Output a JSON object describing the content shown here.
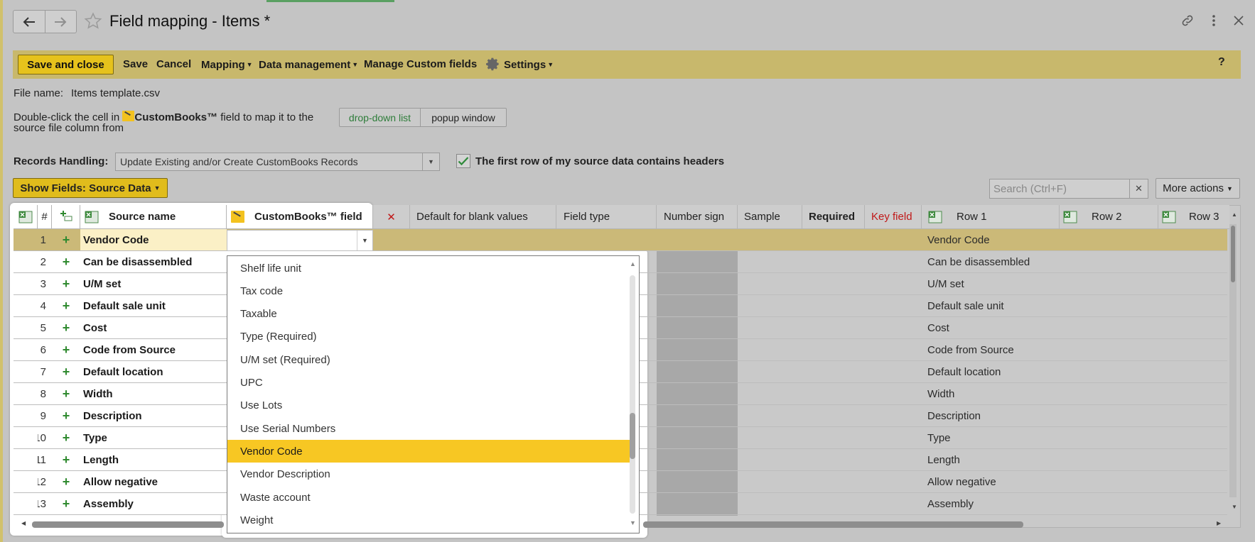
{
  "window": {
    "title": "Field mapping - Items *"
  },
  "toolbar": {
    "save_close": "Save and close",
    "save": "Save",
    "cancel": "Cancel",
    "mapping": "Mapping",
    "data_management": "Data management",
    "manage_custom_fields": "Manage Custom fields",
    "settings": "Settings",
    "help": "?"
  },
  "file": {
    "label": "File name:",
    "value": "Items template.csv"
  },
  "hint": {
    "line1_pre": "Double-click the cell in",
    "brand": "CustomBooks™",
    "line1_post": "field to map it to the",
    "line2": "source file column from"
  },
  "mode_toggle": {
    "dropdown": "drop-down list",
    "popup": "popup window",
    "active": "dropdown"
  },
  "records_handling": {
    "label": "Records Handling:",
    "value": "Update Existing and/or Create CustomBooks Records"
  },
  "headers_checkbox": {
    "label": "The first row of my source data contains headers",
    "checked": true
  },
  "show_fields": "Show Fields: Source Data",
  "search": {
    "placeholder": "Search (Ctrl+F)"
  },
  "more_actions": "More actions",
  "grid": {
    "columns": {
      "num": "#",
      "source_name": "Source name",
      "custombooks_field": "CustomBooks™ field",
      "default_blank": "Default for blank values",
      "field_type": "Field type",
      "number_sign": "Number sign",
      "sample": "Sample",
      "required": "Required",
      "key_field": "Key field",
      "row1": "Row 1",
      "row2": "Row 2",
      "row3": "Row 3"
    },
    "rows": [
      {
        "n": "1",
        "source": "Vendor Code",
        "row1": "Vendor Code"
      },
      {
        "n": "2",
        "source": "Can be disassembled",
        "row1": "Can be disassembled"
      },
      {
        "n": "3",
        "source": "U/M set",
        "row1": "U/M set"
      },
      {
        "n": "4",
        "source": "Default sale unit",
        "row1": "Default sale unit"
      },
      {
        "n": "5",
        "source": "Cost",
        "row1": "Cost"
      },
      {
        "n": "6",
        "source": "Code from Source",
        "row1": "Code from Source"
      },
      {
        "n": "7",
        "source": "Default location",
        "row1": "Default location"
      },
      {
        "n": "8",
        "source": "Width",
        "row1": "Width"
      },
      {
        "n": "9",
        "source": "Description",
        "row1": "Description"
      },
      {
        "n": "10",
        "source": "Type",
        "row1": "Type"
      },
      {
        "n": "11",
        "source": "Length",
        "row1": "Length"
      },
      {
        "n": "12",
        "source": "Allow negative",
        "row1": "Allow negative"
      },
      {
        "n": "13",
        "source": "Assembly",
        "row1": "Assembly"
      }
    ]
  },
  "dropdown": {
    "options": [
      "Shelf life unit",
      "Tax code",
      "Taxable",
      "Type (Required)",
      "U/M set (Required)",
      "UPC",
      "Use Lots",
      "Use Serial Numbers",
      "Vendor Code",
      "Vendor Description",
      "Waste account",
      "Weight"
    ],
    "selected": "Vendor Code"
  },
  "colors": {
    "accent_yellow": "#f7c723",
    "toolbar_bg": "#c8b86c",
    "plus_green": "#2f8a2f",
    "key_field_red": "#c01818"
  },
  "icons": {
    "back": "arrow-left-icon",
    "forward": "arrow-right-icon",
    "favorite": "star-icon",
    "link": "link-icon",
    "menu": "more-vertical-icon",
    "close": "close-icon",
    "settings": "gear-icon",
    "excel": "excel-icon",
    "custombooks": "custombooks-logo-icon",
    "clear_mapping": "red-x-icon"
  }
}
